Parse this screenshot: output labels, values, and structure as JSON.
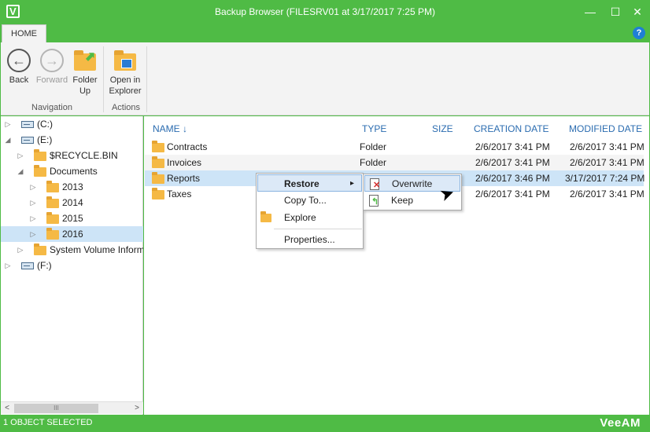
{
  "window": {
    "title": "Backup Browser (FILESRV01 at 3/17/2017 7:25 PM)",
    "app_icon": "V",
    "minimize": "—",
    "maximize": "☐",
    "close": "✕"
  },
  "ribbon": {
    "tab": "HOME",
    "help": "?",
    "buttons": {
      "back": "Back",
      "forward": "Forward",
      "folder_up_1": "Folder",
      "folder_up_2": "Up",
      "open_explorer_1": "Open in",
      "open_explorer_2": "Explorer"
    },
    "groups": {
      "navigation": "Navigation",
      "actions": "Actions"
    }
  },
  "tree": [
    {
      "label": "(C:)",
      "type": "drive"
    },
    {
      "label": "(E:)",
      "type": "drive"
    },
    {
      "label": "$RECYCLE.BIN",
      "type": "folder"
    },
    {
      "label": "Documents",
      "type": "folder"
    },
    {
      "label": "2013",
      "type": "folder"
    },
    {
      "label": "2014",
      "type": "folder"
    },
    {
      "label": "2015",
      "type": "folder"
    },
    {
      "label": "2016",
      "type": "folder"
    },
    {
      "label": "System Volume Inform",
      "type": "folder"
    },
    {
      "label": "(F:)",
      "type": "drive"
    }
  ],
  "scrollbar": {
    "left": "<",
    "right": ">",
    "grip": "III"
  },
  "columns": {
    "name": "NAME",
    "sort_indicator": "↓",
    "type": "TYPE",
    "size": "SIZE",
    "created": "CREATION DATE",
    "modified": "MODIFIED DATE"
  },
  "files": [
    {
      "name": "Contracts",
      "type": "Folder",
      "size": "",
      "created": "2/6/2017 3:41 PM",
      "modified": "2/6/2017 3:41 PM"
    },
    {
      "name": "Invoices",
      "type": "Folder",
      "size": "",
      "created": "2/6/2017 3:41 PM",
      "modified": "2/6/2017 3:41 PM"
    },
    {
      "name": "Reports",
      "type": "",
      "size": "",
      "created": "2/6/2017 3:46 PM",
      "modified": "3/17/2017 7:24 PM"
    },
    {
      "name": "Taxes",
      "type": "",
      "size": "",
      "created": "2/6/2017 3:41 PM",
      "modified": "2/6/2017 3:41 PM"
    }
  ],
  "context_menu": {
    "restore": "Restore",
    "restore_arrow": "▸",
    "copy_to": "Copy To...",
    "explore": "Explore",
    "properties": "Properties..."
  },
  "submenu": {
    "overwrite": "Overwrite",
    "keep": "Keep"
  },
  "status": {
    "text": "1 OBJECT SELECTED",
    "logo": "VeeAM"
  },
  "colors": {
    "brand": "#4fbb45",
    "selection": "#cde4f7",
    "header_text": "#2b6cb0"
  }
}
